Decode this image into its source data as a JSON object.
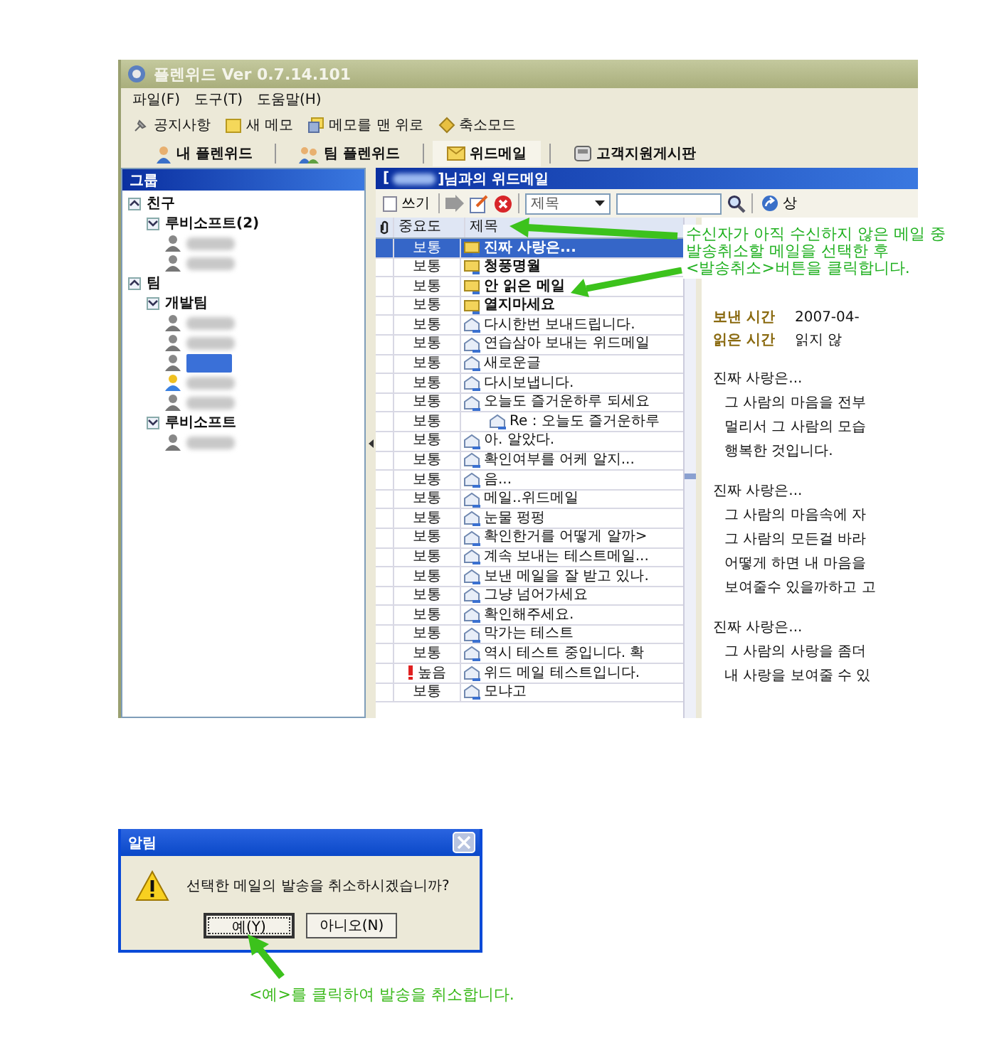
{
  "window": {
    "title": "플렌위드 Ver 0.7.14.101"
  },
  "menu": [
    "파일(F)",
    "도구(T)",
    "도움말(H)"
  ],
  "toolbar": [
    {
      "label": "공지사항",
      "kind": "notice"
    },
    {
      "label": "새 메모",
      "kind": "memo"
    },
    {
      "label": "메모를 맨 위로",
      "kind": "top"
    },
    {
      "label": "축소모드",
      "kind": "mini"
    }
  ],
  "tabs": [
    {
      "label": "내 플렌위드",
      "kind": "person",
      "selected": false
    },
    {
      "label": "팀 플렌위드",
      "kind": "team",
      "selected": false
    },
    {
      "label": "위드메일",
      "kind": "mail",
      "selected": true
    },
    {
      "label": "고객지원게시판",
      "kind": "board",
      "selected": false
    }
  ],
  "groups_panel": {
    "title": "그룹",
    "tree": [
      {
        "label": "친구",
        "expanded": true,
        "children": [
          {
            "label": "루비소프트(2)",
            "expanded": true,
            "children": [
              {
                "kind": "user",
                "selected": false,
                "online": false
              },
              {
                "kind": "user",
                "selected": false,
                "online": false
              }
            ]
          }
        ]
      },
      {
        "label": "팀",
        "expanded": true,
        "children": [
          {
            "label": "개발팀",
            "expanded": true,
            "children": [
              {
                "kind": "user",
                "selected": false,
                "online": false
              },
              {
                "kind": "user",
                "selected": false,
                "online": false
              },
              {
                "kind": "user",
                "selected": true,
                "online": false
              },
              {
                "kind": "user",
                "selected": false,
                "online": true
              },
              {
                "kind": "user",
                "selected": false,
                "online": false
              }
            ]
          },
          {
            "label": "루비소프트",
            "expanded": true,
            "children": [
              {
                "kind": "user",
                "selected": false,
                "online": false
              }
            ]
          }
        ]
      }
    ]
  },
  "mail_panel": {
    "title_before": "[",
    "title_after": "]님과의 위드메일",
    "write": "쓰기",
    "filter": "제목",
    "detail": "상",
    "columns": [
      "중요도",
      "제목"
    ],
    "rows": [
      {
        "importance": "보통",
        "high": false,
        "unread": true,
        "selected": true,
        "subject": "진짜 사랑은..."
      },
      {
        "importance": "보통",
        "high": false,
        "unread": true,
        "selected": false,
        "subject": "청풍명월"
      },
      {
        "importance": "보통",
        "high": false,
        "unread": true,
        "selected": false,
        "subject": "안 읽은 메일"
      },
      {
        "importance": "보통",
        "high": false,
        "unread": true,
        "selected": false,
        "subject": "열지마세요"
      },
      {
        "importance": "보통",
        "high": false,
        "unread": false,
        "selected": false,
        "subject": "다시한번 보내드립니다."
      },
      {
        "importance": "보통",
        "high": false,
        "unread": false,
        "selected": false,
        "subject": "연습삼아 보내는 위드메일"
      },
      {
        "importance": "보통",
        "high": false,
        "unread": false,
        "selected": false,
        "subject": "새로운글"
      },
      {
        "importance": "보통",
        "high": false,
        "unread": false,
        "selected": false,
        "subject": "다시보냅니다."
      },
      {
        "importance": "보통",
        "high": false,
        "unread": false,
        "selected": false,
        "subject": "오늘도 즐거운하루 되세요",
        "children": [
          {
            "importance": "보통",
            "high": false,
            "unread": false,
            "selected": false,
            "subject": "Re : 오늘도 즐거운하루"
          }
        ]
      },
      {
        "importance": "보통",
        "high": false,
        "unread": false,
        "selected": false,
        "subject": "아. 알았다."
      },
      {
        "importance": "보통",
        "high": false,
        "unread": false,
        "selected": false,
        "subject": "확인여부를 어케 알지..."
      },
      {
        "importance": "보통",
        "high": false,
        "unread": false,
        "selected": false,
        "subject": "음..."
      },
      {
        "importance": "보통",
        "high": false,
        "unread": false,
        "selected": false,
        "subject": "메일..위드메일"
      },
      {
        "importance": "보통",
        "high": false,
        "unread": false,
        "selected": false,
        "subject": "눈물 펑펑"
      },
      {
        "importance": "보통",
        "high": false,
        "unread": false,
        "selected": false,
        "subject": "확인한거를 어떻게 알까>"
      },
      {
        "importance": "보통",
        "high": false,
        "unread": false,
        "selected": false,
        "subject": "계속 보내는 테스트메일..."
      },
      {
        "importance": "보통",
        "high": false,
        "unread": false,
        "selected": false,
        "subject": "보낸 메일을 잘 받고 있나."
      },
      {
        "importance": "보통",
        "high": false,
        "unread": false,
        "selected": false,
        "subject": "그냥 넘어가세요"
      },
      {
        "importance": "보통",
        "high": false,
        "unread": false,
        "selected": false,
        "subject": "확인해주세요."
      },
      {
        "importance": "보통",
        "high": false,
        "unread": false,
        "selected": false,
        "subject": "막가는 테스트"
      },
      {
        "importance": "보통",
        "high": false,
        "unread": false,
        "selected": false,
        "subject": "역시 테스트 중입니다. 확"
      },
      {
        "importance": "높음",
        "high": true,
        "unread": false,
        "selected": false,
        "subject": "위드 메일 테스트입니다."
      },
      {
        "importance": "보통",
        "high": false,
        "unread": false,
        "selected": false,
        "subject": "모냐고"
      }
    ]
  },
  "preview": {
    "fields": [
      {
        "label": "보낸 시간",
        "value": "2007-04-"
      },
      {
        "label": "읽은 시간",
        "value": "읽지 않"
      }
    ],
    "paragraphs": [
      [
        "진짜 사랑은...",
        "그 사람의 마음을 전부",
        "멀리서 그 사람의 모습",
        "행복한 것입니다."
      ],
      [
        "진짜 사랑은...",
        "그 사람의 마음속에 자",
        "그 사람의 모든걸 바라",
        "어떻게 하면 내 마음을",
        "보여줄수 있을까하고 고"
      ],
      [
        "진짜 사랑은...",
        "그 사람의 사랑을 좀더",
        "내 사랑을 보여줄 수 있"
      ]
    ]
  },
  "annotation": "수신자가 아직 수신하지 않은 메일 중\n발송취소할 메일을 선택한 후\n<발송취소>버튼을 클릭합니다.",
  "dialog": {
    "title": "알림",
    "message": "선택한 메일의 발송을 취소하시겠습니까?",
    "buttons": [
      {
        "label": "예(Y)",
        "focused": true
      },
      {
        "label": "아니오(N)",
        "focused": false
      }
    ]
  },
  "caption": "<예>를 클릭하여 발송을 취소합니다."
}
